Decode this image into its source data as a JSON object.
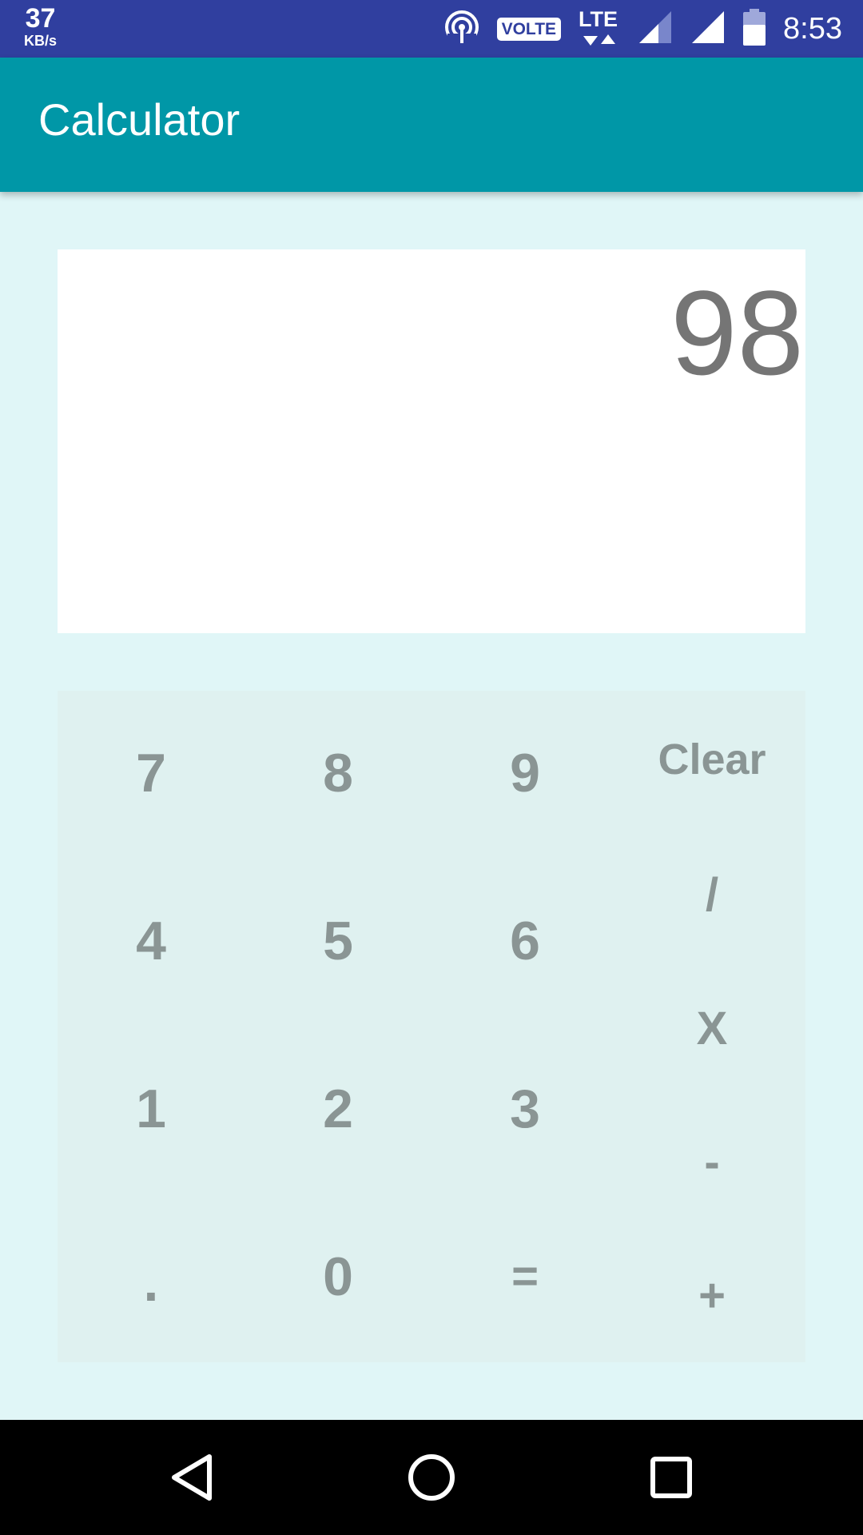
{
  "status_bar": {
    "speed_value": "37",
    "speed_unit": "KB/s",
    "volte": "VOLTE",
    "network": "LTE",
    "time": "8:53",
    "icons": [
      "hotspot-icon",
      "volte-icon",
      "lte-data-icon",
      "signal-icon",
      "signal-icon",
      "battery-icon"
    ]
  },
  "app_bar": {
    "title": "Calculator"
  },
  "display": {
    "value": "98"
  },
  "keypad": {
    "keys": {
      "seven": "7",
      "eight": "8",
      "nine": "9",
      "clear": "Clear",
      "four": "4",
      "five": "5",
      "six": "6",
      "divide": "/",
      "multiply": "X",
      "one": "1",
      "two": "2",
      "three": "3",
      "subtract": "-",
      "dot": ".",
      "zero": "0",
      "equals": "=",
      "add": "+"
    }
  },
  "nav_bar": {
    "buttons": [
      "back-icon",
      "home-icon",
      "recents-icon"
    ]
  },
  "colors": {
    "status_bar": "#303f9f",
    "app_bar": "#0097a7",
    "background": "#e0f6f7",
    "keypad": "#dff1f0",
    "display_text": "#757575",
    "key_text": "#8a9594"
  }
}
